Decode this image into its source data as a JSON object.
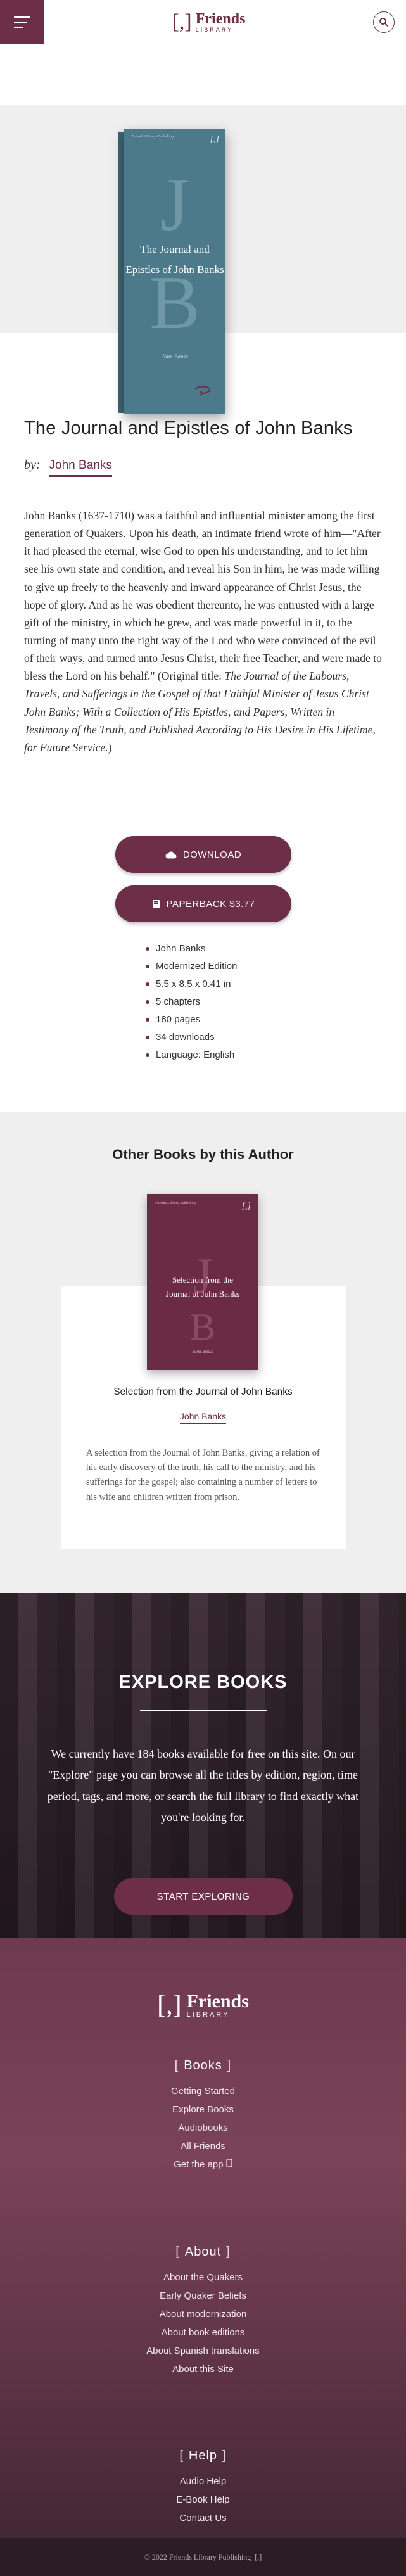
{
  "header": {
    "logo_mark": "[,]",
    "logo_word": "Friends",
    "logo_sub": "LIBRARY"
  },
  "cover": {
    "series": "Friends Library Publishing",
    "logo": "[,]",
    "monogram_1": "J",
    "monogram_2": "B",
    "title_line1": "The Journal and",
    "title_line2": "Epistles of John Banks",
    "author": "John Banks",
    "spine_text": "The Journal and Epistles of John Banks"
  },
  "book": {
    "title": "The Journal and Epistles of John Banks",
    "by_label": "by:",
    "author": "John Banks",
    "description": "John Banks (1637-1710) was a faithful and influential minister among the first generation of Quakers. Upon his death, an intimate friend wrote of him—\"After it had pleased the eternal, wise God to open his understanding, and to let him see his own state and condition, and reveal his Son in him, he was made willing to give up freely to the heavenly and inward appearance of Christ Jesus, the hope of glory. And as he was obedient thereunto, he was entrusted with a large gift of the ministry, in which he grew, and was made powerful in it, to the turning of many unto the right way of the Lord who were convinced of the evil of their ways, and turned unto Jesus Christ, their free Teacher, and were made to bless the Lord on his behalf.\" (Original title: ",
    "original_title": "The Journal of the Labours, Travels, and Sufferings in the Gospel of that Faithful Minister of Jesus Christ John Banks; With a Collection of His Epistles, and Papers, Written in Testimony of the Truth, and Published According to His Desire in His Lifetime, for Future Service.",
    "description_end": ")"
  },
  "actions": {
    "download": "DOWNLOAD",
    "paperback": "PAPERBACK $3.77"
  },
  "meta": [
    "John Banks",
    "Modernized Edition",
    "5.5 x 8.5 x 0.41 in",
    "5 chapters",
    "180 pages",
    "34 downloads",
    "Language: English"
  ],
  "others": {
    "heading": "Other Books by this Author",
    "cover_series": "Friends Library Publishing",
    "cover_logo": "[,]",
    "cover_j": "J",
    "cover_b": "B",
    "cover_title1": "Selection from the",
    "cover_title2": "Journal of John Banks",
    "cover_author": "John Banks",
    "title": "Selection from the Journal of John Banks",
    "author": "John Banks",
    "description": "A selection from the Journal of John Banks, giving a relation of his early discovery of the truth, his call to the ministry, and his sufferings for the gospel; also containing a number of letters to his wife and children written from prison."
  },
  "explore": {
    "title": "EXPLORE BOOKS",
    "text": "We currently have 184 books available for free on this site. On our \"Explore\" page you can browse all the titles by edition, region, time period, tags, and more, or search the full library to find exactly what you're looking for.",
    "button": "START EXPLORING"
  },
  "footer": {
    "books_heading": "Books",
    "books_links": [
      "Getting Started",
      "Explore Books",
      "Audiobooks",
      "All Friends",
      "Get the app"
    ],
    "about_heading": "About",
    "about_links": [
      "About the Quakers",
      "Early Quaker Beliefs",
      "About modernization",
      "About book editions",
      "About Spanish translations",
      "About this Site"
    ],
    "help_heading": "Help",
    "help_links": [
      "Audio Help",
      "E-Book Help",
      "Contact Us"
    ],
    "copyright": "© 2022 Friends Library Publishing",
    "copyright_mark": "[,]"
  },
  "colors": {
    "brand": "#6d2e48",
    "cover": "#4d7a8a"
  }
}
